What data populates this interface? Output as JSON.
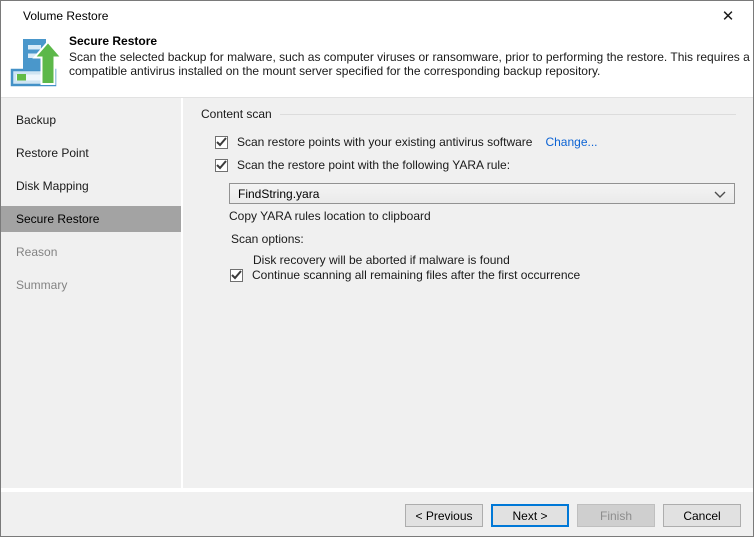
{
  "window": {
    "title": "Volume Restore",
    "close_icon_glyph": "✕"
  },
  "header": {
    "title": "Secure Restore",
    "description_line1": "Scan the selected backup for malware, such as computer viruses or ransomware, prior to performing the restore. This requires a",
    "description_line2": "compatible antivirus installed on the mount server specified for the corresponding backup repository."
  },
  "sidebar": {
    "items": [
      {
        "label": "Backup",
        "state": "enabled"
      },
      {
        "label": "Restore Point",
        "state": "enabled"
      },
      {
        "label": "Disk Mapping",
        "state": "enabled"
      },
      {
        "label": "Secure Restore",
        "state": "active"
      },
      {
        "label": "Reason",
        "state": "disabled"
      },
      {
        "label": "Summary",
        "state": "disabled"
      }
    ]
  },
  "content": {
    "group_label": "Content scan",
    "antivirus_checkbox": {
      "label": "Scan restore points with your existing antivirus software",
      "checked": true
    },
    "change_link": "Change...",
    "yara_checkbox": {
      "label": "Scan the restore point with the following YARA rule:",
      "checked": true
    },
    "yara_combo": {
      "value": "FindString.yara"
    },
    "copy_link": "Copy YARA rules location to clipboard",
    "scan_options_label": "Scan options:",
    "abort_note": "Disk recovery will be aborted if malware is found",
    "continue_checkbox": {
      "label": "Continue scanning all remaining files after the first occurrence",
      "checked": true
    }
  },
  "footer": {
    "buttons": [
      {
        "label": "< Previous",
        "role": "previous",
        "state": "enabled"
      },
      {
        "label": "Next >",
        "role": "next",
        "state": "default"
      },
      {
        "label": "Finish",
        "role": "finish",
        "state": "disabled"
      },
      {
        "label": "Cancel",
        "role": "cancel",
        "state": "enabled"
      }
    ]
  },
  "colors": {
    "accent_blue": "#0078d7",
    "link_blue": "#0c63d4",
    "sidebar_highlight": "#a3a3a3",
    "panel_gray": "#f0f0f0",
    "icon_blue": "#4a97cb",
    "icon_green": "#5cb849"
  }
}
